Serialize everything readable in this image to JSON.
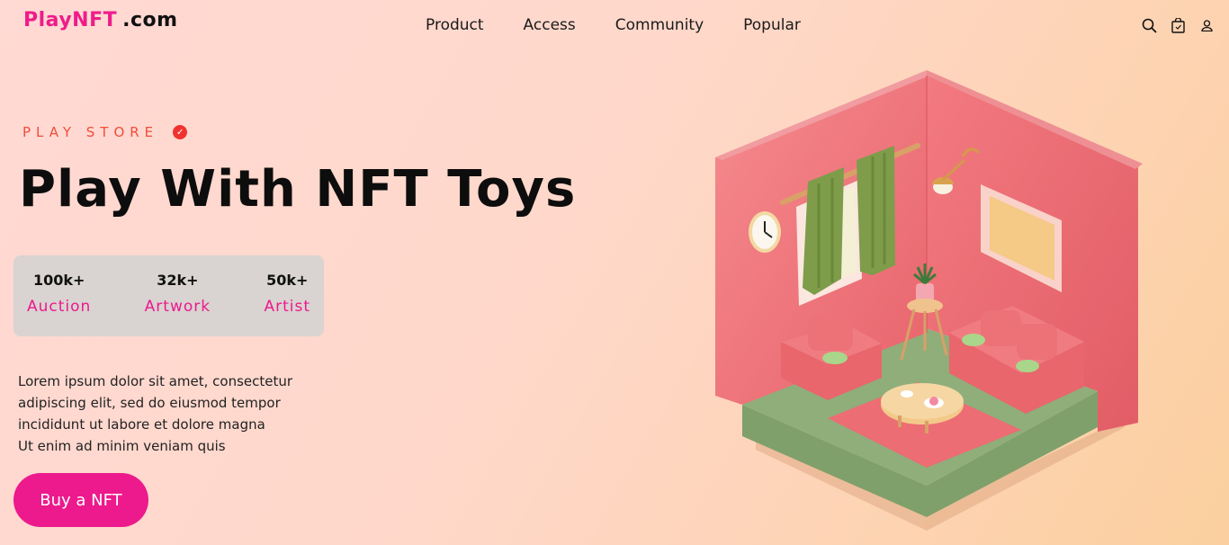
{
  "brand": {
    "name": "PlayNFT",
    "domain": ".com"
  },
  "nav": {
    "items": [
      "Product",
      "Access",
      "Community",
      "Popular"
    ]
  },
  "header_icons": [
    "search-icon",
    "bag-icon",
    "user-icon"
  ],
  "hero": {
    "eyebrow": "PLAY STORE",
    "title": "Play With NFT Toys",
    "stats": [
      {
        "value": "100k+",
        "label": "Auction"
      },
      {
        "value": "32k+",
        "label": "Artwork"
      },
      {
        "value": "50k+",
        "label": "Artist"
      }
    ],
    "description": [
      "Lorem ipsum dolor sit amet, consectetur",
      "adipiscing elit, sed do eiusmod tempor",
      "incididunt ut labore et dolore magna",
      "Ut enim ad minim veniam quis"
    ],
    "cta_label": "Buy a NFT"
  },
  "colors": {
    "accent": "#ec1a8c",
    "eyebrow": "#f04d3a",
    "stats_bg": "#d9d3d1"
  }
}
